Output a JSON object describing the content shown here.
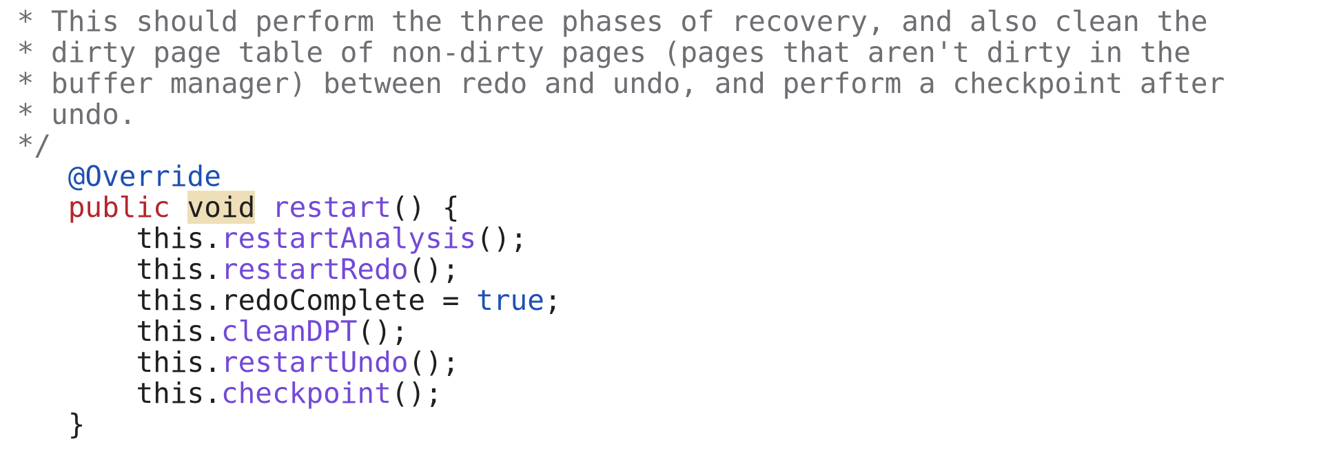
{
  "editor": {
    "comment_lines": [
      " * This should perform the three phases of recovery, and also clean the",
      " * dirty page table of non-dirty pages (pages that aren't dirty in the",
      " * buffer manager) between redo and undo, and perform a checkpoint after",
      " * undo.",
      " */"
    ],
    "annotation": "@Override",
    "signature": {
      "modifier": "public",
      "return_type": "void",
      "name": "restart",
      "rest": "() {"
    },
    "body_indent": "        ",
    "method_indent": "    ",
    "receiver": "this.",
    "statements": [
      {
        "method": "restartAnalysis",
        "suffix": "();"
      },
      {
        "method": "restartRedo",
        "suffix": "();"
      },
      {
        "field": "redoComplete = ",
        "literal": "true",
        "suffix": ";"
      },
      {
        "method": "cleanDPT",
        "suffix": "();"
      },
      {
        "method": "restartUndo",
        "suffix": "();"
      },
      {
        "method": "checkpoint",
        "suffix": "();"
      }
    ],
    "closing_brace": "}",
    "colors": {
      "comment": "#6e6e73",
      "annotation": "#1e4fb3",
      "keyword": "#b3262d",
      "method": "#7349d8",
      "literal": "#1e4fb3",
      "highlight": "#eedfb8",
      "text": "#1f1f1f"
    }
  }
}
